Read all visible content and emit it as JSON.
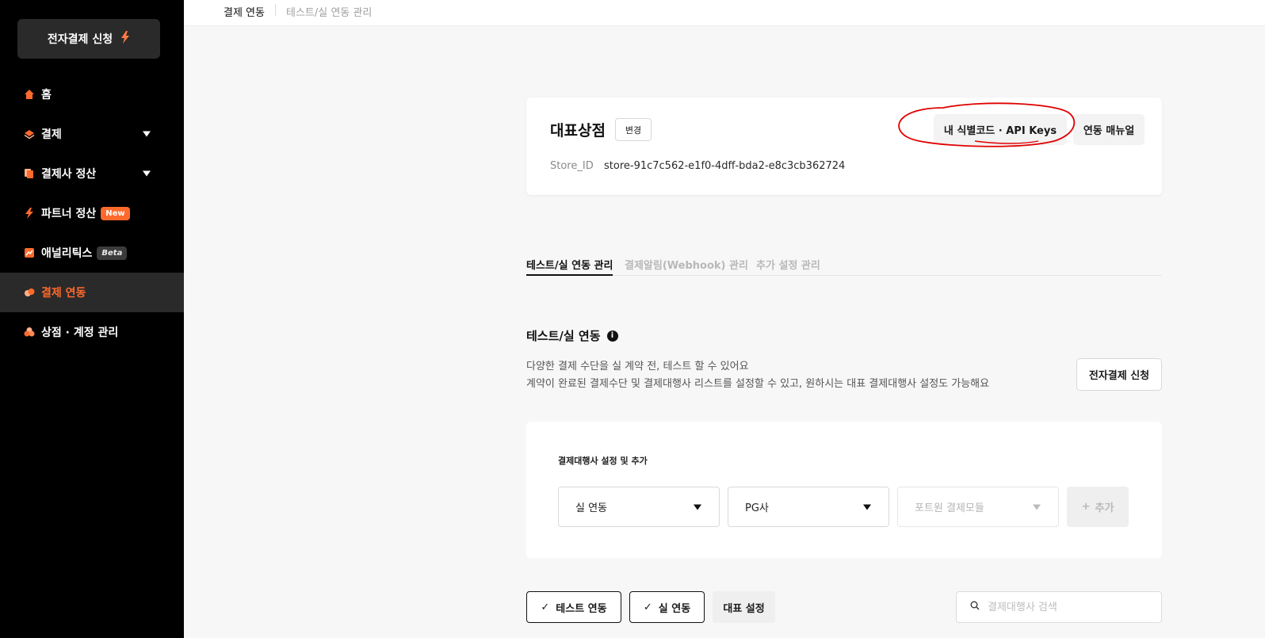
{
  "sidebar": {
    "apply_button": "전자결제 신청",
    "items": [
      {
        "label": "홈",
        "icon": "home-icon"
      },
      {
        "label": "결제",
        "icon": "layers-icon",
        "has_caret": true
      },
      {
        "label": "결제사 정산",
        "icon": "document-icon",
        "has_caret": true
      },
      {
        "label": "파트너 정산",
        "icon": "bolt-icon",
        "badge": "New"
      },
      {
        "label": "애널리틱스",
        "icon": "chart-icon",
        "badge": "Beta"
      },
      {
        "label": "결제 연동",
        "icon": "link-icon",
        "active": true
      },
      {
        "label": "상점 · 계정 관리",
        "icon": "store-icon"
      }
    ]
  },
  "header": {
    "breadcrumb": [
      "결제 연동",
      "테스트/실 연동 관리"
    ]
  },
  "store": {
    "title": "대표상점",
    "change_label": "변경",
    "store_id_label": "Store_ID",
    "store_id_value": "store-91c7c562-e1f0-4dff-bda2-e8c3cb362724",
    "api_keys_label": "내 식별코드 · API Keys",
    "manual_label": "연동 매뉴얼"
  },
  "tabs": [
    "테스트/실 연동 관리",
    "결제알림(Webhook) 관리",
    "추가 설정 관리"
  ],
  "section": {
    "title": "테스트/실 연동",
    "desc1": "다양한 결제 수단을 실 계약 전, 테스트 할 수 있어요",
    "desc2": "계약이 완료된 결제수단 및 결제대행사 리스트를 설정할 수 있고, 원하시는 대표 결제대행사 설정도 가능해요",
    "apply_label": "전자결제 신청"
  },
  "pg_panel": {
    "label": "결제대행사 설정 및 추가",
    "select1": "실 연동",
    "select2": "PG사",
    "select3_placeholder": "포트원 결제모듈",
    "add_label": "추가"
  },
  "filters": {
    "test_chip": "테스트 연동",
    "live_chip": "실 연동",
    "rep_label": "대표 설정",
    "search_placeholder": "결제대행사 검색"
  },
  "colors": {
    "accent": "#ff6a2c",
    "sidebar_bg": "#000000",
    "annotation": "#e00000"
  }
}
